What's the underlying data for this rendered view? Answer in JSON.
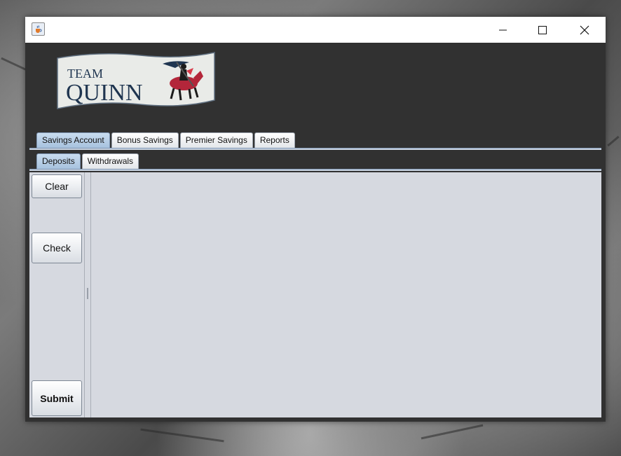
{
  "window": {
    "controls": [
      "minimize-icon",
      "maximize-icon",
      "close-icon"
    ],
    "app_icon": "java-cup-icon"
  },
  "logo": {
    "line1": "TEAM",
    "line2": "QUINN",
    "icon": "knight-on-horse-icon"
  },
  "main_tabs": [
    {
      "label": "Savings Account",
      "selected": true
    },
    {
      "label": "Bonus Savings",
      "selected": false
    },
    {
      "label": "Premier Savings",
      "selected": false
    },
    {
      "label": "Reports",
      "selected": false
    }
  ],
  "sub_tabs": [
    {
      "label": "Deposits",
      "selected": true
    },
    {
      "label": "Withdrawals",
      "selected": false
    }
  ],
  "buttons": {
    "clear": "Clear",
    "check": "Check",
    "submit": "Submit"
  },
  "colors": {
    "window_bg": "#313131",
    "tab_selected": "#a7c2de",
    "panel_bg": "#d6d9e0",
    "logo_text": "#1f3550"
  }
}
